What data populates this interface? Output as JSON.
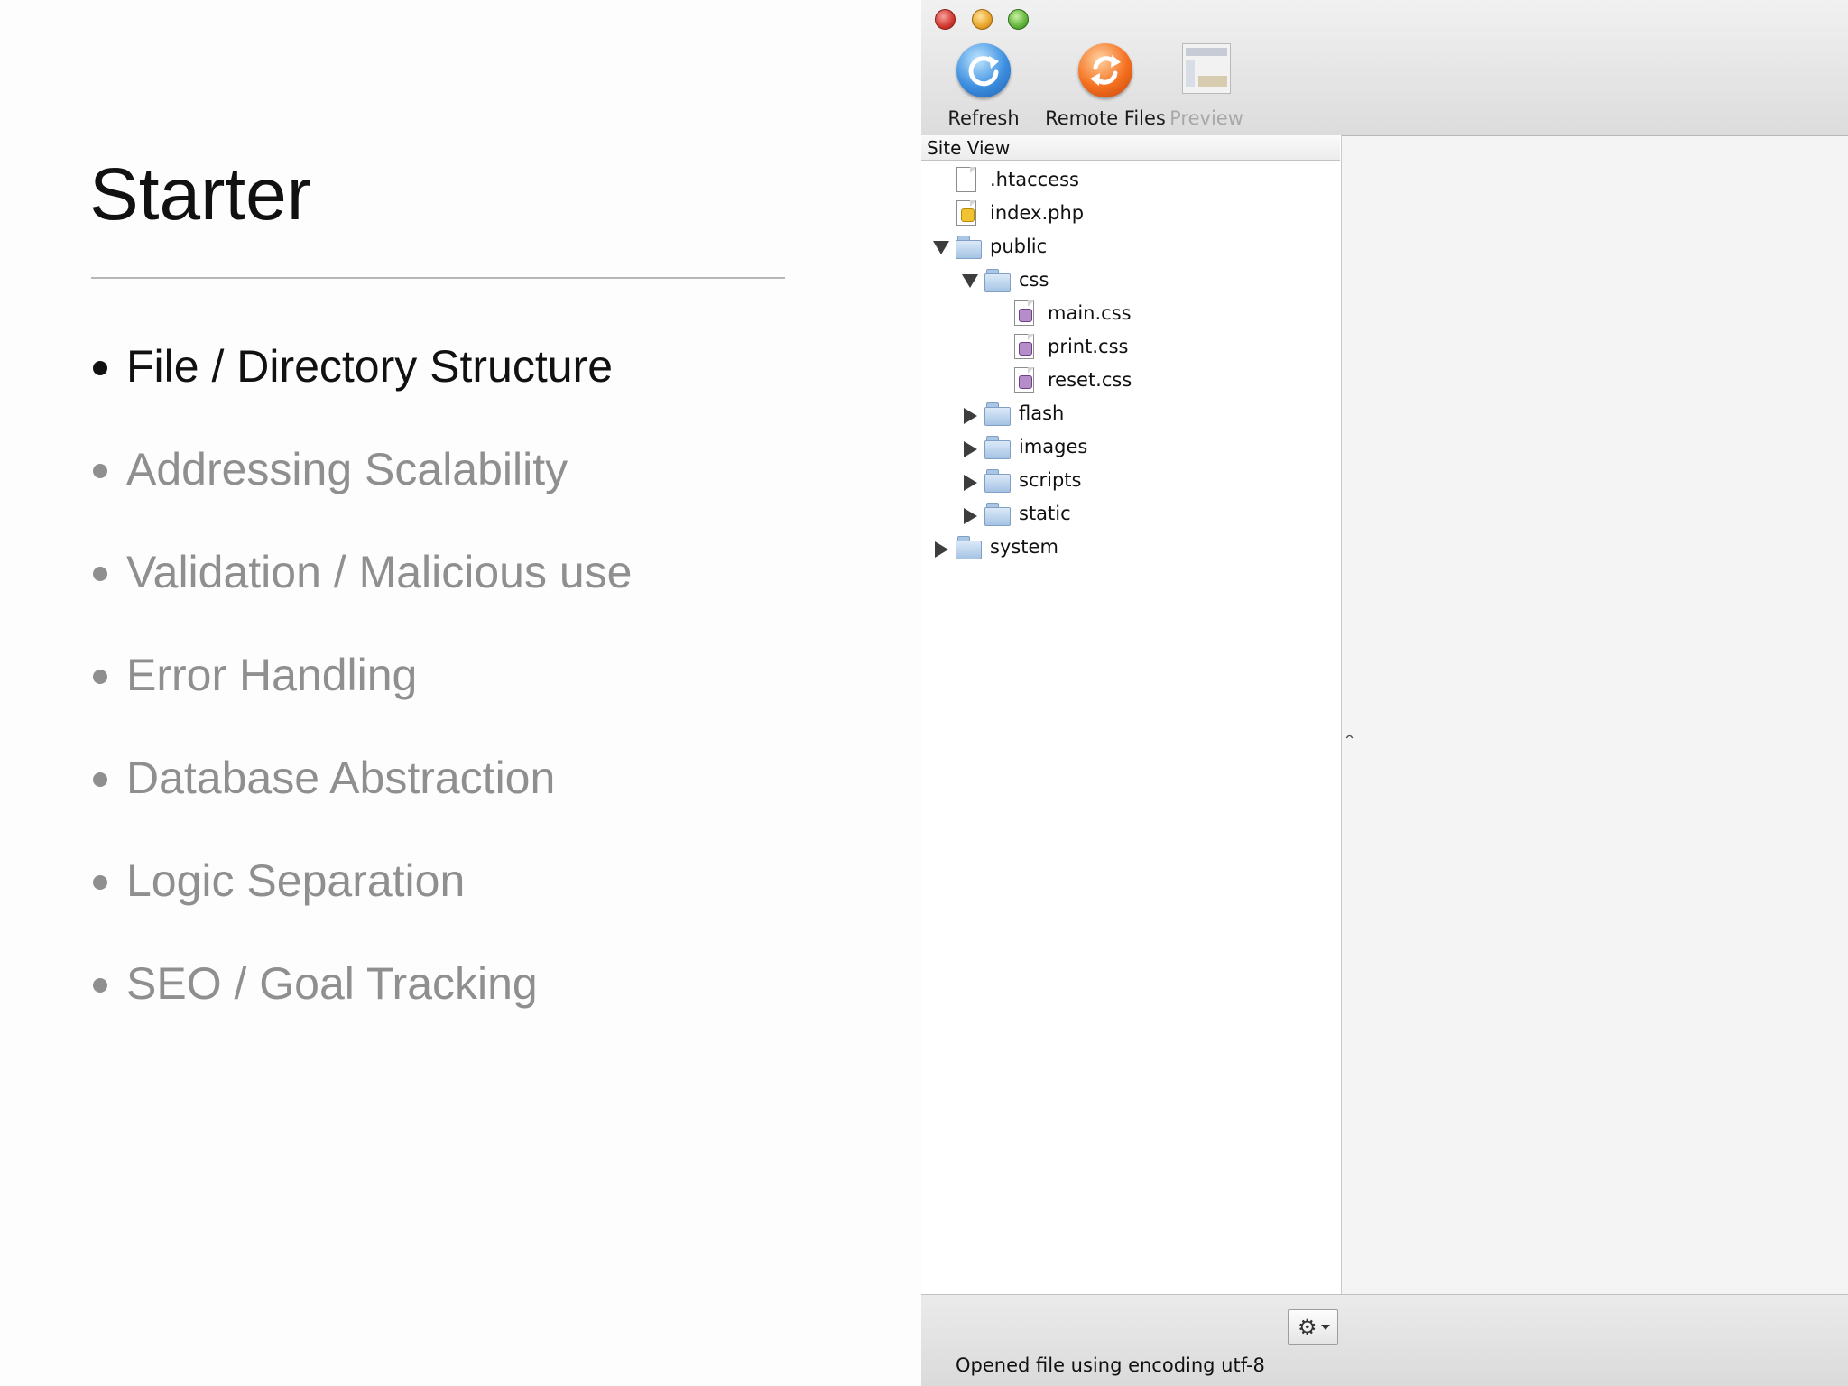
{
  "slide": {
    "title": "Starter",
    "bullets": [
      {
        "label": "File / Directory Structure",
        "active": true
      },
      {
        "label": "Addressing Scalability",
        "active": false
      },
      {
        "label": "Validation / Malicious use",
        "active": false
      },
      {
        "label": "Error Handling",
        "active": false
      },
      {
        "label": "Database Abstraction",
        "active": false
      },
      {
        "label": "Logic Separation",
        "active": false
      },
      {
        "label": "SEO / Goal Tracking",
        "active": false
      }
    ]
  },
  "app": {
    "toolbar": {
      "refresh_label": "Refresh",
      "remote_files_label": "Remote Files",
      "preview_label": "Preview"
    },
    "site_view": {
      "header": "Site View",
      "tree": [
        {
          "name": ".htaccess",
          "type": "file",
          "icon": "generic-file-icon"
        },
        {
          "name": "index.php",
          "type": "file",
          "icon": "php-file-icon"
        },
        {
          "name": "public",
          "type": "folder",
          "expanded": true
        },
        {
          "name": "css",
          "type": "folder",
          "expanded": true
        },
        {
          "name": "main.css",
          "type": "file",
          "icon": "css-file-icon"
        },
        {
          "name": "print.css",
          "type": "file",
          "icon": "css-file-icon"
        },
        {
          "name": "reset.css",
          "type": "file",
          "icon": "css-file-icon"
        },
        {
          "name": "flash",
          "type": "folder",
          "expanded": false
        },
        {
          "name": "images",
          "type": "folder",
          "expanded": false
        },
        {
          "name": "scripts",
          "type": "folder",
          "expanded": false
        },
        {
          "name": "static",
          "type": "folder",
          "expanded": false
        },
        {
          "name": "system",
          "type": "folder",
          "expanded": false
        }
      ]
    },
    "status": {
      "message": "Opened file using encoding utf-8",
      "gear_icon": "gear-icon"
    },
    "colors": {
      "close": "#d2372f",
      "minimize": "#e9a42b",
      "maximize": "#5fb33a",
      "refresh_icon": "#3d8fe0",
      "remote_icon": "#f4701f"
    }
  }
}
